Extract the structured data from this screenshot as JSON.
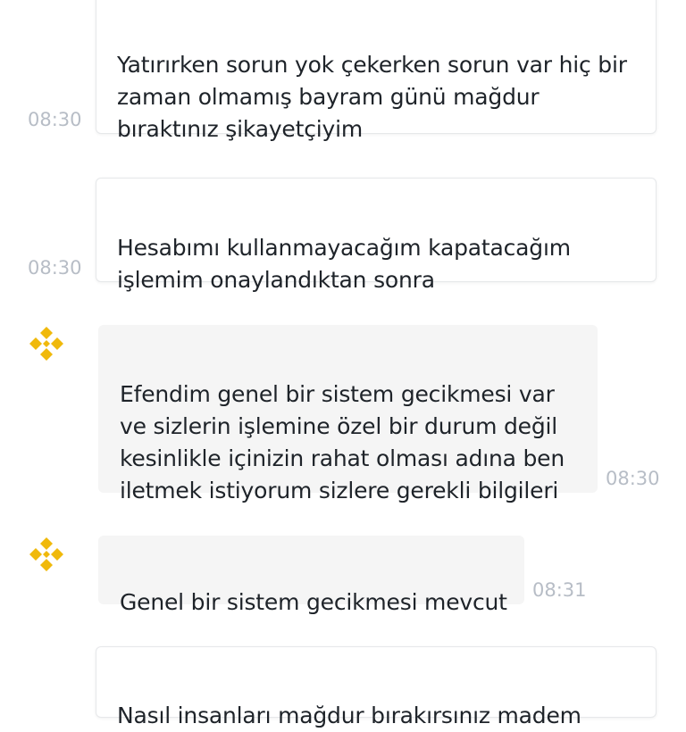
{
  "chat": {
    "messages": [
      {
        "sender": "user",
        "text": "Yatırırken sorun yok çekerken sorun var hiç bir\nzaman olmamış bayram günü mağdur\nbıraktınız şikayetçiyim",
        "time": "08:30"
      },
      {
        "sender": "user",
        "text": "Hesabımı kullanmayacağım kapatacağım\nişlemim onaylandıktan sonra",
        "time": "08:30"
      },
      {
        "sender": "agent",
        "avatar_icon": "binance-logo-icon",
        "text": "Efendim genel bir sistem gecikmesi var\nve sizlerin işlemine özel bir durum değil\nkesinlikle içinizin rahat olması adına ben\niletmek istiyorum sizlere gerekli bilgileri",
        "time": "08:30"
      },
      {
        "sender": "agent",
        "avatar_icon": "binance-logo-icon",
        "text": "Genel bir sistem gecikmesi mevcut",
        "time": "08:31"
      },
      {
        "sender": "user",
        "text": "Nasıl insanları mağdur bırakırsınız madem",
        "time": ""
      }
    ]
  },
  "colors": {
    "brand": "#F0B90B",
    "agent_bubble": "#F5F5F5",
    "timestamp": "#B7BDC6"
  }
}
